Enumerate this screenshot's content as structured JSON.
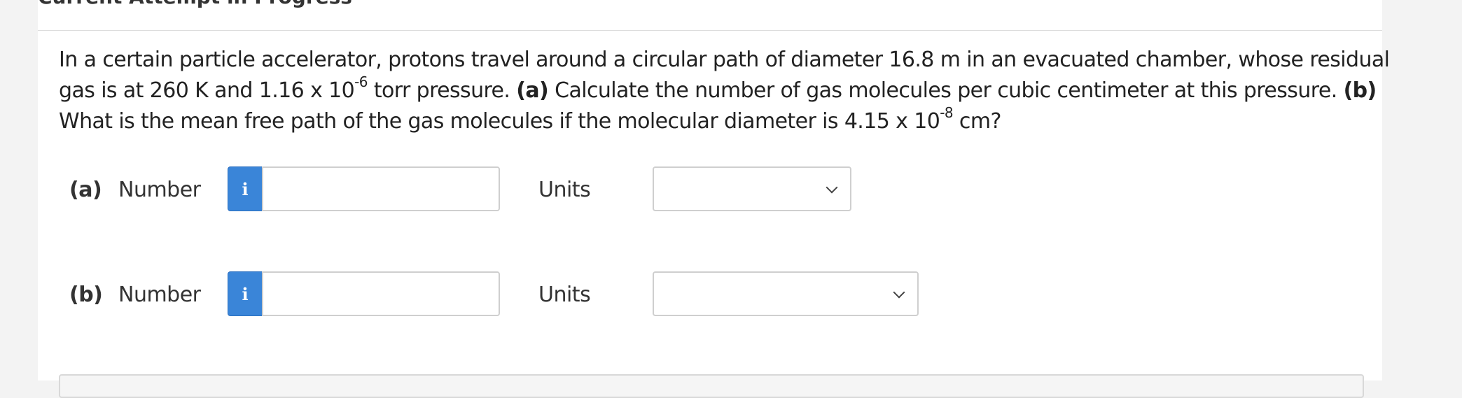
{
  "page": {
    "heading": "Current Attempt in Progress"
  },
  "question": {
    "text_1": "In a certain particle accelerator, protons travel around a circular path of diameter 16.8 m in an evacuated chamber, whose residual gas is at 260 K and 1.16 x 10",
    "exp_1": "-6",
    "text_2": " torr pressure. ",
    "part_a_marker": "(a)",
    "text_3": " Calculate the number of gas molecules per cubic centimeter at this pressure. ",
    "part_b_marker": "(b)",
    "text_4": " What is the mean free path of the gas molecules if the molecular diameter is 4.15 x 10",
    "exp_2": "-8",
    "text_5": " cm?"
  },
  "answers": [
    {
      "part": "(a)",
      "number_label": "Number",
      "number_value": "",
      "units_label": "Units",
      "units_selected": ""
    },
    {
      "part": "(b)",
      "number_label": "Number",
      "number_value": "",
      "units_label": "Units",
      "units_selected": ""
    }
  ],
  "icons": {
    "info": "info-icon",
    "dropdown": "chevron-down-icon"
  },
  "colors": {
    "info_button": "#3a85d8",
    "input_border": "#cfcfcf",
    "text": "#222222"
  }
}
